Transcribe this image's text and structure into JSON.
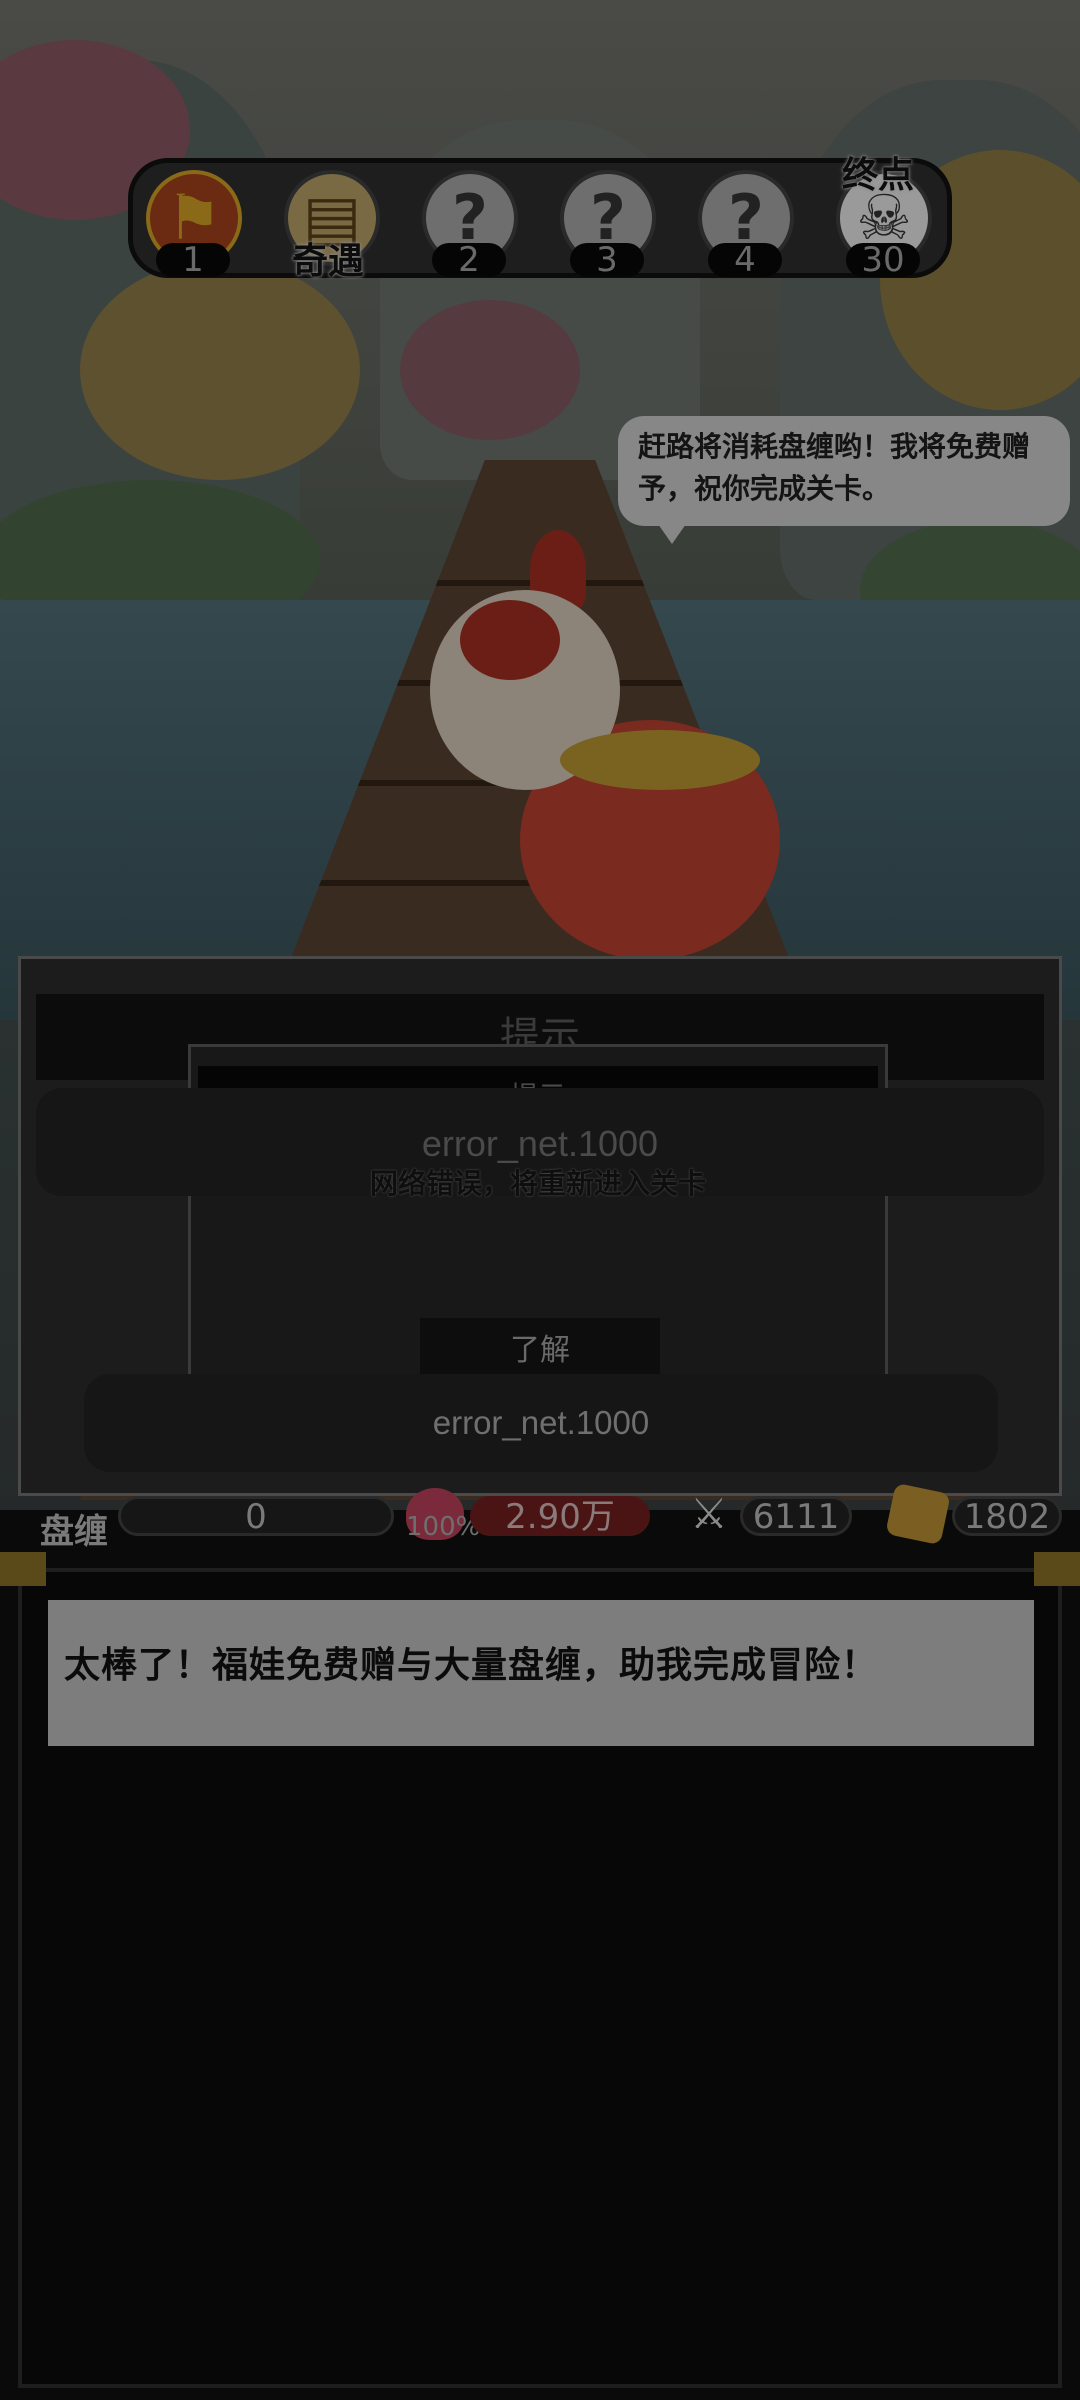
{
  "progress": {
    "nodes": [
      {
        "label": "1"
      },
      {
        "label": "奇遇"
      },
      {
        "label": "2"
      },
      {
        "label": "3"
      },
      {
        "label": "4"
      },
      {
        "label": "30"
      }
    ],
    "end_label": "终点",
    "unknown_glyph": "?"
  },
  "speech_bubble": {
    "text": "赶路将消耗盘缠哟！我将免费赠予，祝你完成关卡。"
  },
  "dialog_outer": {
    "title": "提示",
    "toast": "error_net.1000"
  },
  "dialog_inner": {
    "title": "提示",
    "message": "网络错误，将重新进入关卡",
    "confirm_label": "了解"
  },
  "toast_bottom": "error_net.1000",
  "stats": {
    "money_label": "盘缠",
    "money_value": "0",
    "hp_percent": "100%",
    "hp_value": "2.90万",
    "attack_value": "6111",
    "gold_value": "1802"
  },
  "message_panel": {
    "text": "太棒了！福娃免费赠与大量盘缠，助我完成冒险！"
  },
  "colors": {
    "accent_red": "#6b2a12",
    "accent_gold": "#8a6a18"
  }
}
